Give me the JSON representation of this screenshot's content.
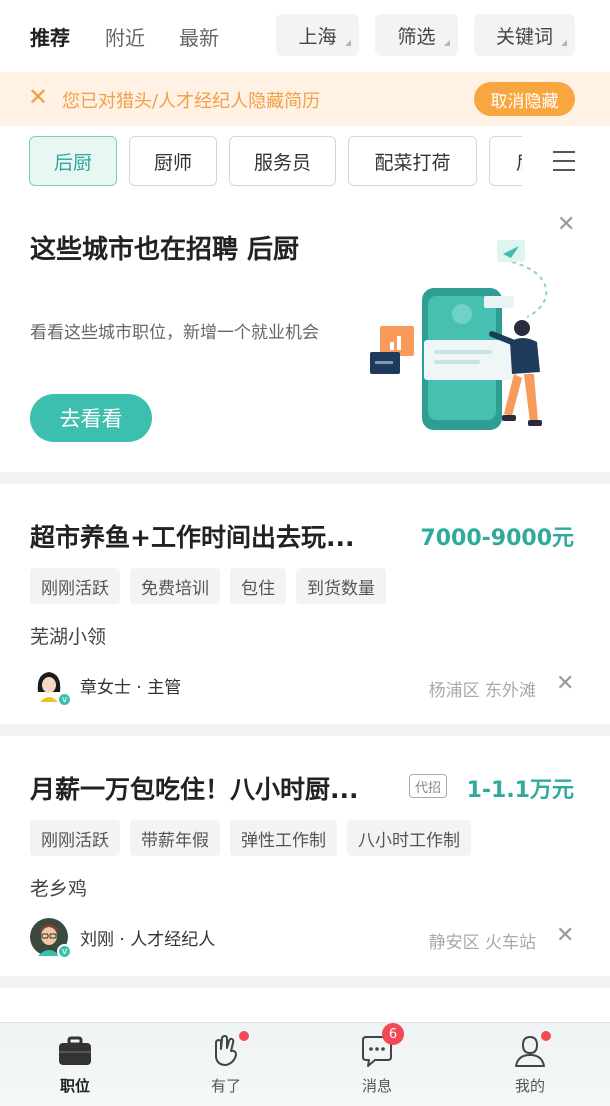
{
  "top_tabs": [
    "推荐",
    "附近",
    "最新"
  ],
  "filters": {
    "city": "上海",
    "filter": "筛选",
    "keyword": "关键词"
  },
  "notice": {
    "text": "您已对猎头/人才经纪人隐藏简历",
    "button": "取消隐藏"
  },
  "categories": [
    "后厨",
    "厨师",
    "服务员",
    "配菜打荷",
    "后"
  ],
  "promo": {
    "title": "这些城市也在招聘 后厨",
    "subtitle": "看看这些城市职位，新增一个就业机会",
    "button": "去看看"
  },
  "jobs": [
    {
      "title": "超市养鱼+工作时间出去玩...",
      "salary": "7000-9000元",
      "tags": [
        "刚刚活跃",
        "免费培训",
        "包住",
        "到货数量"
      ],
      "company": "芜湖小领",
      "recruiter": "章女士 · 主管",
      "location": "杨浦区 东外滩"
    },
    {
      "title": "月薪一万包吃住！八小时厨...",
      "agency_badge": "代招",
      "salary": "1-1.1万元",
      "tags": [
        "刚刚活跃",
        "带薪年假",
        "弹性工作制",
        "八小时工作制"
      ],
      "company": "老乡鸡",
      "recruiter": "刘刚 · 人才经纪人",
      "location": "静安区 火车站"
    }
  ],
  "bottom_nav": [
    {
      "label": "职位",
      "icon": "briefcase-icon"
    },
    {
      "label": "有了",
      "icon": "hand-icon"
    },
    {
      "label": "消息",
      "icon": "chat-icon",
      "badge": "6"
    },
    {
      "label": "我的",
      "icon": "user-icon"
    }
  ],
  "colors": {
    "accent": "#3cbfae",
    "salary": "#30aa9d",
    "notice": "#f0a04a",
    "badge": "#f24a55"
  }
}
